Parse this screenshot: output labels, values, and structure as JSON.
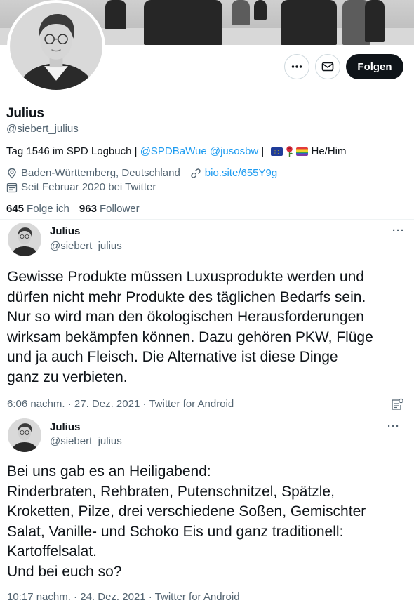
{
  "profile": {
    "name": "Julius",
    "handle": "@siebert_julius",
    "bio": {
      "prefix": "Tag 1546 im SPD Logbuch | ",
      "mentions": "@SPDBaWue @jusosbw",
      "separator": " | ",
      "emojis": [
        "eu-flag",
        "rose",
        "rainbow-flag"
      ],
      "suffix": "He/Him"
    },
    "location": "Baden-Württemberg, Deutschland",
    "website": "bio.site/655Y9g",
    "joined": "Seit Februar 2020 bei Twitter",
    "following_count": "645",
    "following_label": "Folge ich",
    "followers_count": "963",
    "followers_label": "Follower"
  },
  "actions": {
    "more_icon": "more-horizontal-icon",
    "message_icon": "envelope-icon",
    "follow_label": "Folgen"
  },
  "tweets": [
    {
      "name": "Julius",
      "handle": "@siebert_julius",
      "text": "Gewisse Produkte müssen Luxusprodukte werden und\ndürfen nicht mehr Produkte des täglichen Bedarfs sein.\nNur so wird man den ökologischen Herausforderungen\nwirksam bekämpfen können. Dazu gehören PKW, Flüge\nund ja auch Fleisch. Die Alternative ist diese Dinge\nganz zu verbieten.",
      "meta": "6:06 nachm. · 27. Dez. 2021 · Twitter for Android"
    },
    {
      "name": "Julius",
      "handle": "@siebert_julius",
      "text": "Bei uns gab es an Heiligabend:\nRinderbraten, Rehbraten, Putenschnitzel, Spätzle,\nKroketten, Pilze, drei verschiedene Soßen, Gemischter\nSalat, Vanille- und Schoko Eis und ganz traditionell:\nKartoffelsalat.\nUnd bei euch so?",
      "meta": "10:17 nachm. · 24. Dez. 2021 · Twitter for Android"
    }
  ],
  "colors": {
    "text": "#0f1419",
    "secondary": "#536471",
    "link": "#1d9bf0",
    "follow_button": "#0f1419"
  }
}
